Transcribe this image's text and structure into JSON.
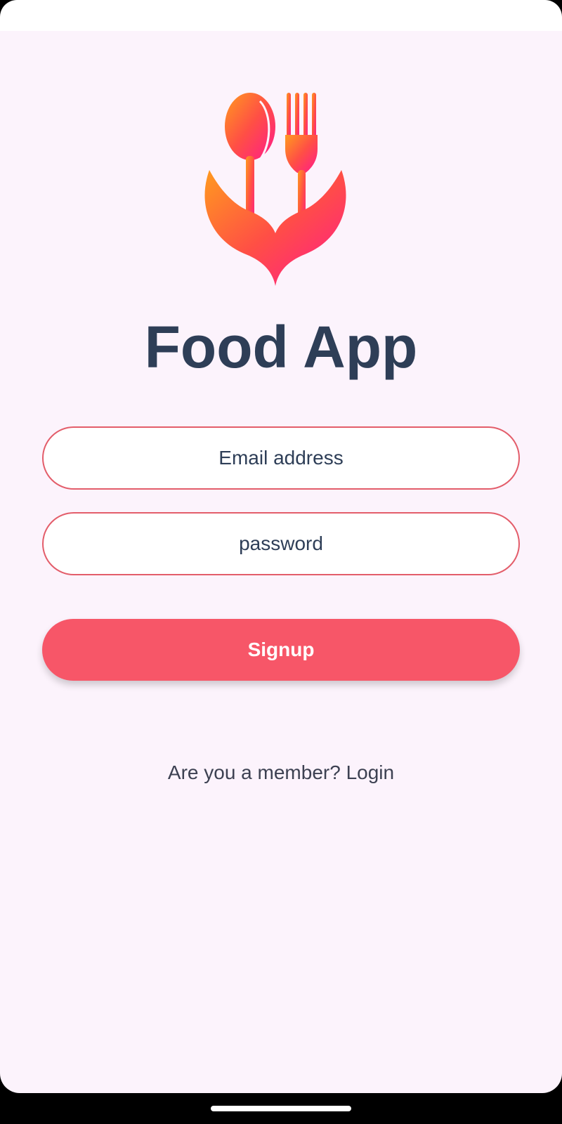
{
  "app": {
    "title": "Food App",
    "logo_icon": "spoon-fork-heart-icon",
    "brand_gradient": [
      "#ff8a22",
      "#ff4e4e",
      "#ff1a8c"
    ]
  },
  "form": {
    "email_placeholder": "Email address",
    "password_placeholder": "password",
    "signup_label": "Signup",
    "login_prompt": "Are you a member? Login"
  },
  "colors": {
    "title": "#2e3e57",
    "accent": "#f75668",
    "field_border": "#e35d6a",
    "background": "#fcf3fc"
  }
}
